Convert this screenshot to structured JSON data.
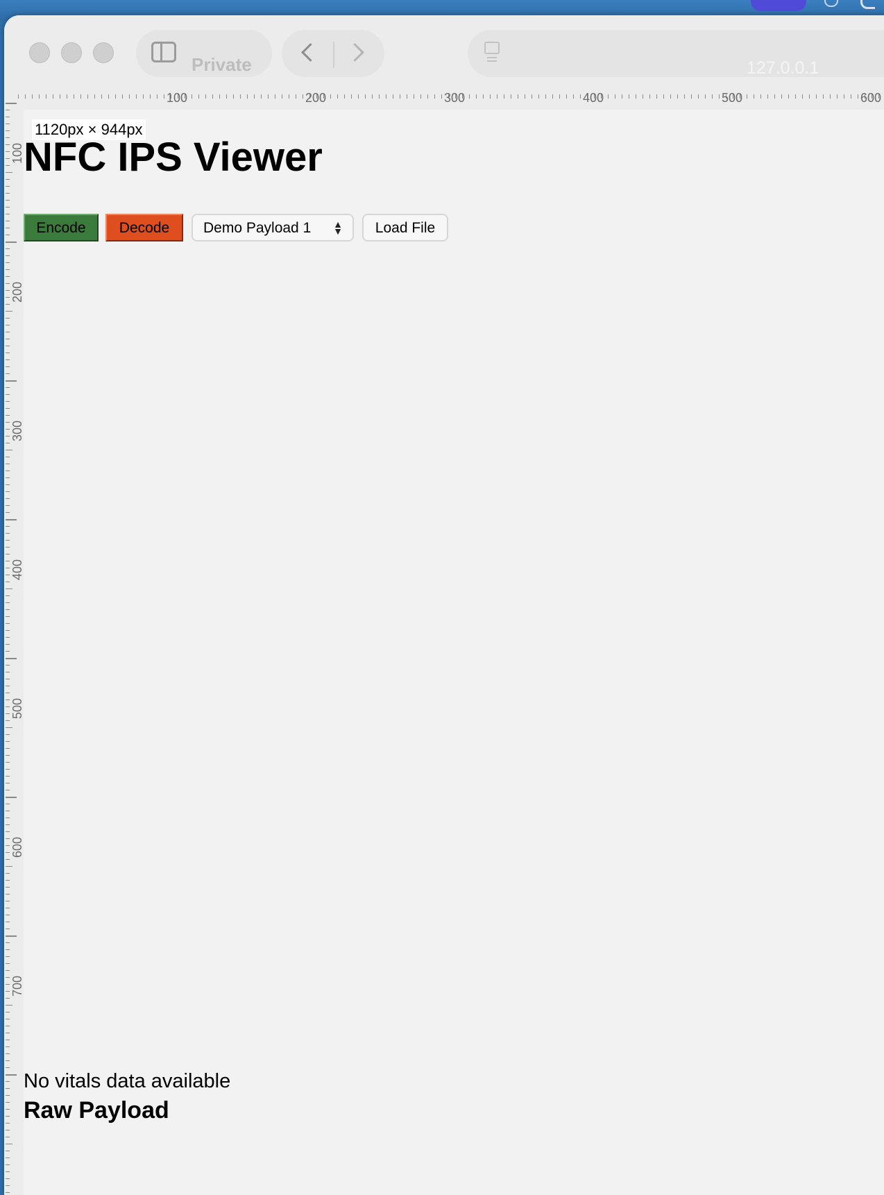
{
  "browser": {
    "private_label": "Private",
    "address": "127.0.0.1",
    "icons": [
      "sidebar-toggle-icon",
      "back-chevron-icon",
      "forward-chevron-icon",
      "page-icon"
    ]
  },
  "rulers": {
    "horizontal_labels": [
      "100",
      "200",
      "300",
      "400",
      "500",
      "600"
    ],
    "vertical_labels": [
      "100",
      "200",
      "300",
      "400",
      "500",
      "600",
      "700"
    ]
  },
  "page": {
    "size_badge": "1120px × 944px",
    "title": "NFC IPS Viewer",
    "toolbar": {
      "encode_label": "Encode",
      "decode_label": "Decode",
      "payload_select_value": "Demo Payload 1",
      "load_file_label": "Load File"
    },
    "vitals_status": "No vitals data available",
    "raw_payload_heading": "Raw Payload"
  },
  "colors": {
    "encode_button": "#3a7a3a",
    "decode_button": "#de4e1e",
    "page_background": "#f2f2f2",
    "desktop_background": "#2f6fa8"
  }
}
